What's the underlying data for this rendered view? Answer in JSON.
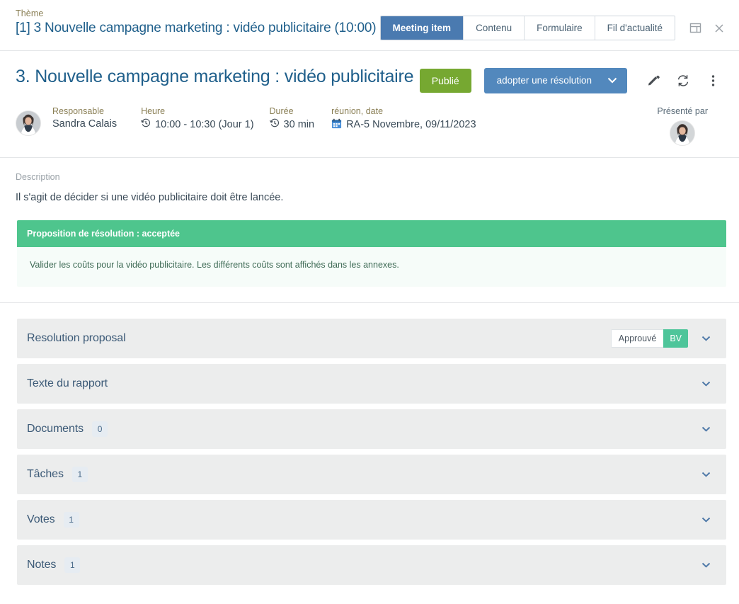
{
  "topbar": {
    "breadcrumb_label": "Thème",
    "window_title": "[1] 3 Nouvelle campagne marketing : vidéo publicitaire (10:00)",
    "tabs": [
      {
        "label": "Meeting item",
        "active": true
      },
      {
        "label": "Contenu",
        "active": false
      },
      {
        "label": "Formulaire",
        "active": false
      },
      {
        "label": "Fil d'actualité",
        "active": false
      }
    ],
    "window_icons": [
      {
        "name": "panel-layout-icon",
        "glyph": "▣"
      },
      {
        "name": "close-icon",
        "glyph": "✕"
      }
    ]
  },
  "header": {
    "title": "3. Nouvelle campagne marketing : vidéo publicitaire",
    "status_badge": "Publié",
    "primary_button": "adopter une résolution",
    "primary_button_caret": "❯",
    "edit_icon": "✎",
    "sync_icon": "⟳",
    "more_icon": "⋮"
  },
  "meta": {
    "responsable": {
      "label": "Responsable",
      "value": "Sandra Calais"
    },
    "heure": {
      "label": "Heure",
      "value": "10:00 - 10:30 (Jour 1)",
      "icon": "clock-icon"
    },
    "duree": {
      "label": "Durée",
      "value": "30 min",
      "icon": "clock-icon"
    },
    "reunion": {
      "label": "réunion, date",
      "value": "RA-5 Novembre, 09/11/2023",
      "icon": "calendar-icon"
    },
    "presented_by_label": "Présenté par"
  },
  "description": {
    "label": "Description",
    "text": "Il s'agit de décider si une vidéo publicitaire doit être lancée."
  },
  "banner": {
    "title": "Proposition de résolution : acceptée",
    "body": "Valider les coûts pour la vidéo publicitaire. Les différents coûts sont affichés dans les annexes.",
    "header_color": "#4ec58d",
    "body_color": "#f6fcf9"
  },
  "accordions": [
    {
      "title": "Resolution proposal",
      "count": null,
      "approval_label": "Approuvé",
      "approval_badge": "BV",
      "chevron": "❯"
    },
    {
      "title": "Texte du rapport",
      "count": null,
      "chevron": "❯"
    },
    {
      "title": "Documents",
      "count": "0",
      "chevron": "❯"
    },
    {
      "title": "Tâches",
      "count": "1",
      "chevron": "❯"
    },
    {
      "title": "Votes",
      "count": "1",
      "chevron": "❯"
    },
    {
      "title": "Notes",
      "count": "1",
      "chevron": "❯"
    }
  ],
  "colors": {
    "accent_blue": "#4a7ab0",
    "title_blue": "#1f5f8b",
    "status_green": "#76a831",
    "banner_green": "#4ec58d",
    "badge_green": "#4ec59a",
    "accordion_bg": "#eceded"
  }
}
